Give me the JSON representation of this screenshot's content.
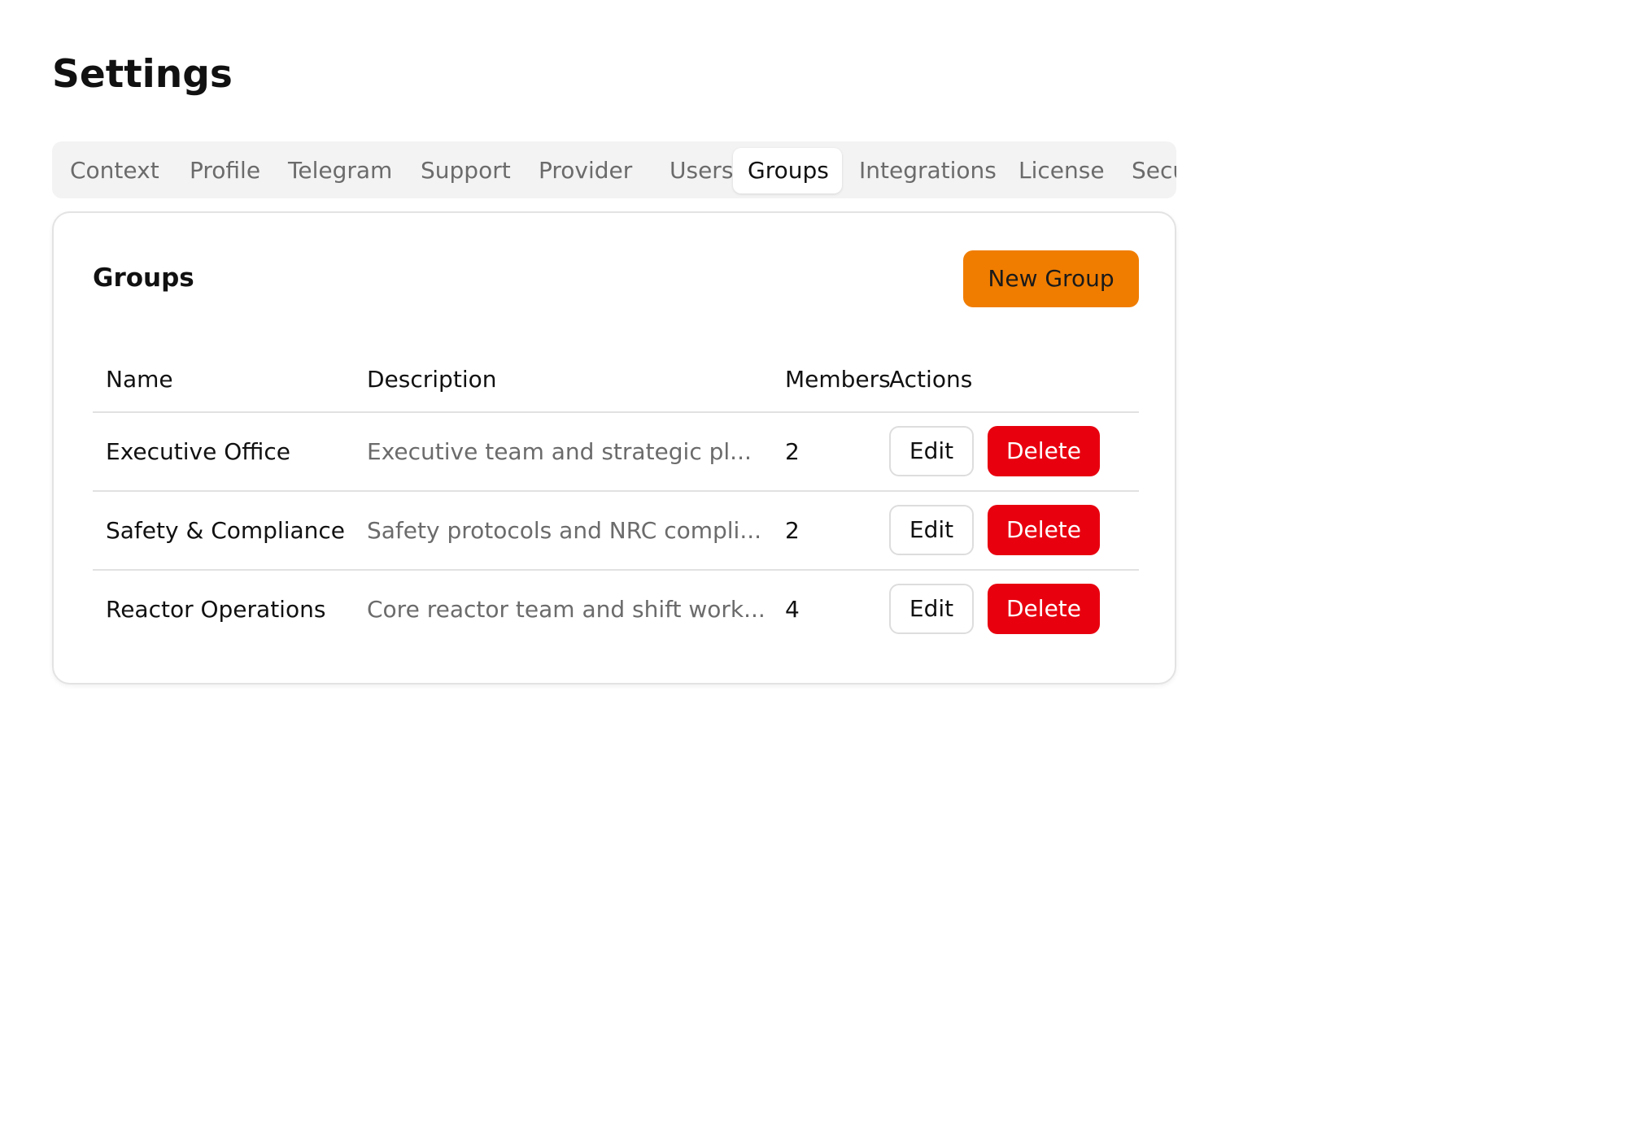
{
  "page": {
    "title": "Settings"
  },
  "tabs": [
    {
      "label": "Context",
      "active": false
    },
    {
      "label": "Profile",
      "active": false
    },
    {
      "label": "Telegram",
      "active": false
    },
    {
      "label": "Support",
      "active": false
    },
    {
      "label": "Provider",
      "active": false
    },
    {
      "label": "Users",
      "active": false
    },
    {
      "label": "Groups",
      "active": true
    },
    {
      "label": "Integrations",
      "active": false
    },
    {
      "label": "License",
      "active": false
    },
    {
      "label": "Secu",
      "active": false
    }
  ],
  "groups_panel": {
    "title": "Groups",
    "new_button_label": "New Group",
    "columns": {
      "name": "Name",
      "description": "Description",
      "members": "Members",
      "actions": "Actions"
    },
    "rows": [
      {
        "name": "Executive Office",
        "description": "Executive team and strategic pl...",
        "members": "2",
        "edit_label": "Edit",
        "delete_label": "Delete"
      },
      {
        "name": "Safety & Compliance",
        "description": "Safety protocols and NRC compli...",
        "members": "2",
        "edit_label": "Edit",
        "delete_label": "Delete"
      },
      {
        "name": "Reactor Operations",
        "description": "Core reactor team and shift work...",
        "members": "4",
        "edit_label": "Edit",
        "delete_label": "Delete"
      }
    ]
  },
  "colors": {
    "accent": "#f07d00",
    "danger": "#e8000f",
    "muted_text": "#6b6b6b",
    "tab_bar_bg": "#f3f3f3"
  }
}
